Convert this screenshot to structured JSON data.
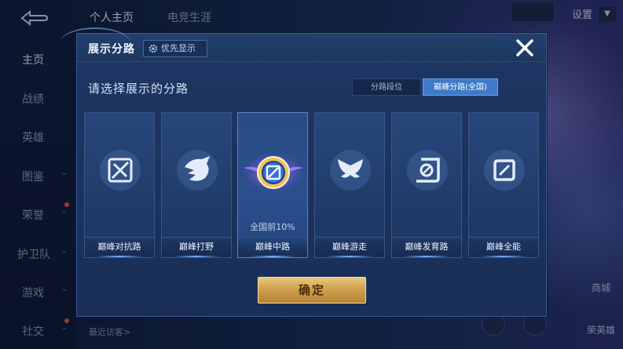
{
  "background": {
    "left_nav": [
      {
        "label": "主页",
        "active": true
      },
      {
        "label": "战绩"
      },
      {
        "label": "英雄"
      },
      {
        "label": "图鉴",
        "chevron": true
      },
      {
        "label": "荣誉",
        "chevron": true
      },
      {
        "label": "护卫队",
        "chevron": true
      },
      {
        "label": "游戏",
        "chevron": true
      },
      {
        "label": "社交",
        "chevron": true
      }
    ],
    "top_tabs": [
      "个人主页",
      "电竞生涯"
    ],
    "settings_label": "设置",
    "recent_visitors_label": "最近访客>",
    "right_labels": [
      "商城",
      "荣英雄"
    ]
  },
  "dialog": {
    "title": "展示分路",
    "priority_label": "优先显示",
    "subtitle": "请选择展示的分路",
    "segments": [
      {
        "label": "分路段位",
        "active": false
      },
      {
        "label": "巅峰分路(全国)",
        "active": true
      }
    ],
    "cards": [
      {
        "label": "巅峰对抗路",
        "icon": "sword-shield-icon",
        "rank": ""
      },
      {
        "label": "巅峰打野",
        "icon": "wolf-icon",
        "rank": ""
      },
      {
        "label": "巅峰中路",
        "icon": "mid-lane-emblem-icon",
        "rank": "全国前10%",
        "selected": true
      },
      {
        "label": "巅峰游走",
        "icon": "wings-icon",
        "rank": ""
      },
      {
        "label": "巅峰发育路",
        "icon": "bow-icon",
        "rank": ""
      },
      {
        "label": "巅峰全能",
        "icon": "all-round-icon",
        "rank": ""
      }
    ],
    "confirm_label": "确定"
  },
  "colors": {
    "dialog_bg": "#1e3663",
    "accent_blue": "#3f7ac8",
    "confirm_gold": "#c99a47"
  }
}
